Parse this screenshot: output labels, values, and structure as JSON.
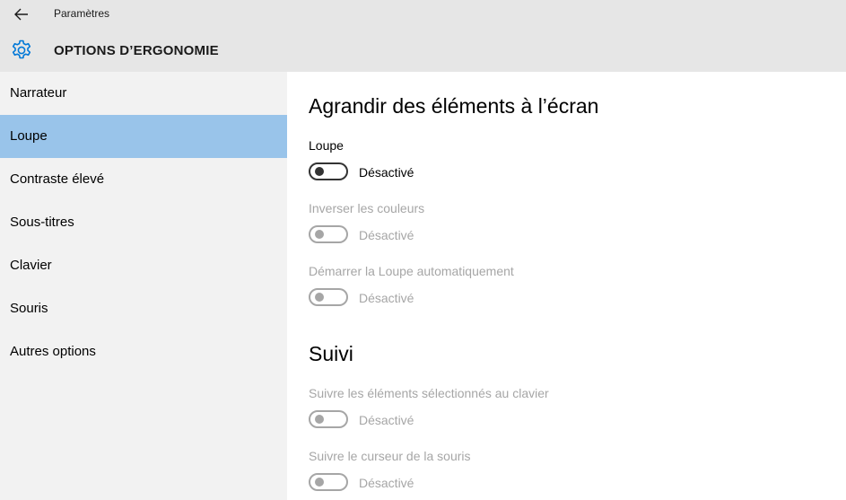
{
  "window": {
    "title": "Paramètres"
  },
  "header": {
    "title": "OPTIONS D’ERGONOMIE"
  },
  "sidebar": {
    "items": [
      {
        "label": "Narrateur"
      },
      {
        "label": "Loupe"
      },
      {
        "label": "Contraste élevé"
      },
      {
        "label": "Sous-titres"
      },
      {
        "label": "Clavier"
      },
      {
        "label": "Souris"
      },
      {
        "label": "Autres options"
      }
    ],
    "selected": "Loupe"
  },
  "main": {
    "sections": [
      {
        "title": "Agrandir des éléments à l’écran",
        "settings": [
          {
            "label": "Loupe",
            "state": "Désactivé",
            "enabled": true
          },
          {
            "label": "Inverser les couleurs",
            "state": "Désactivé",
            "enabled": false
          },
          {
            "label": "Démarrer la Loupe automatiquement",
            "state": "Désactivé",
            "enabled": false
          }
        ]
      },
      {
        "title": "Suivi",
        "settings": [
          {
            "label": "Suivre les éléments sélectionnés au clavier",
            "state": "Désactivé",
            "enabled": false
          },
          {
            "label": "Suivre le curseur de la souris",
            "state": "Désactivé",
            "enabled": false
          }
        ]
      }
    ]
  },
  "colors": {
    "chrome": "#e6e6e6",
    "sidebar": "#f2f2f2",
    "selected": "#99c4ea",
    "accent": "#0078d7",
    "disabled": "#a6a6a6"
  },
  "icons": {
    "back": "arrow-left-icon",
    "settings": "gear-icon"
  }
}
